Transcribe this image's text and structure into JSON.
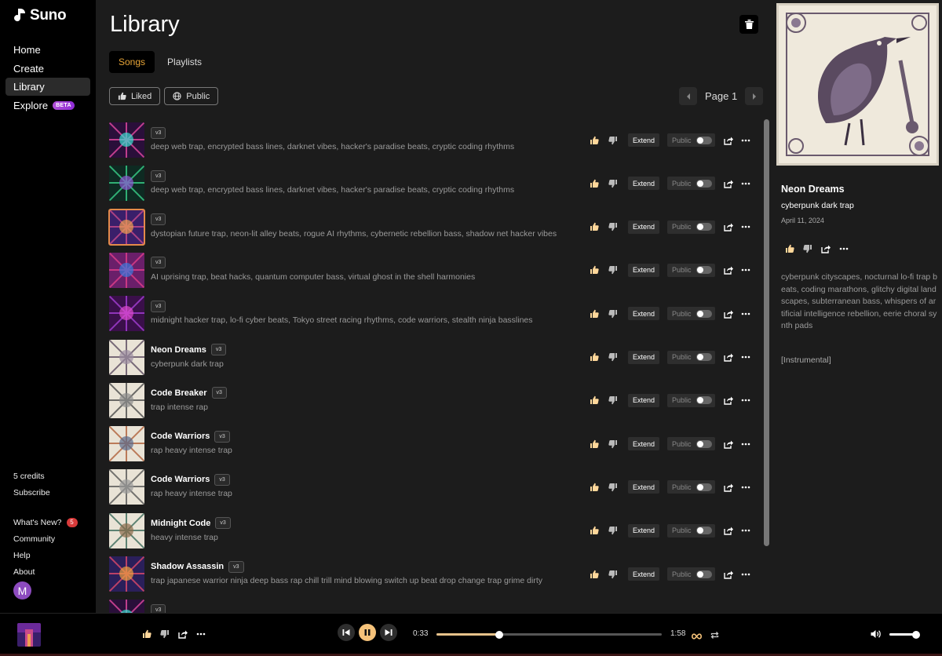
{
  "brand": {
    "name": "Suno"
  },
  "nav": {
    "items": [
      {
        "label": "Home"
      },
      {
        "label": "Create"
      },
      {
        "label": "Library"
      },
      {
        "label": "Explore"
      }
    ],
    "beta_label": "BETA"
  },
  "sidebar_bottom": {
    "credits": "5 credits",
    "subscribe": "Subscribe",
    "whats_new": "What's New?",
    "whats_new_count": "5",
    "community": "Community",
    "help": "Help",
    "about": "About",
    "avatar_initial": "M"
  },
  "library": {
    "title": "Library",
    "tabs": [
      {
        "label": "Songs"
      },
      {
        "label": "Playlists"
      }
    ],
    "filters": {
      "liked": "Liked",
      "public": "Public"
    },
    "page_label": "Page 1"
  },
  "song_row_labels": {
    "version": "v3",
    "extend": "Extend",
    "public": "Public"
  },
  "songs": [
    {
      "title": "",
      "desc": "deep web trap, encrypted bass lines, darknet vibes, hacker's paradise beats, cryptic coding rhythms"
    },
    {
      "title": "",
      "desc": "deep web trap, encrypted bass lines, darknet vibes, hacker's paradise beats, cryptic coding rhythms"
    },
    {
      "title": "",
      "desc": "dystopian future trap, neon-lit alley beats, rogue AI rhythms, cybernetic rebellion bass, shadow net hacker vibes"
    },
    {
      "title": "",
      "desc": "AI uprising trap, beat hacks, quantum computer bass, virtual ghost in the shell harmonies"
    },
    {
      "title": "",
      "desc": "midnight hacker trap, lo-fi cyber beats, Tokyo street racing rhythms, code warriors, stealth ninja basslines"
    },
    {
      "title": "Neon Dreams",
      "desc": "cyberpunk dark trap"
    },
    {
      "title": "Code Breaker",
      "desc": "trap intense rap"
    },
    {
      "title": "Code Warriors",
      "desc": "rap heavy intense trap"
    },
    {
      "title": "Code Warriors",
      "desc": "rap heavy intense trap"
    },
    {
      "title": "Midnight Code",
      "desc": "heavy intense trap"
    },
    {
      "title": "Shadow Assassin",
      "desc": "trap japanese warrior ninja deep bass rap chill trill mind blowing switch up beat drop change trap grime dirty"
    }
  ],
  "panel": {
    "title": "Neon Dreams",
    "style": "cyberpunk dark trap",
    "date": "April 11, 2024",
    "tags": "cyberpunk cityscapes, nocturnal lo-fi trap beats, coding marathons, glitchy digital landscapes, subterranean bass, whispers of artificial intelligence rebellion, eerie choral synth pads",
    "lyrics": "[Instrumental]"
  },
  "player": {
    "current_time": "0:33",
    "duration": "1:58",
    "progress_fraction": 0.28,
    "volume_fraction": 0.9
  },
  "colors": {
    "accent": "#e6a437",
    "play_button": "#f5c27a",
    "beta_badge": "#b14fd7",
    "notification": "#d83a3a"
  }
}
